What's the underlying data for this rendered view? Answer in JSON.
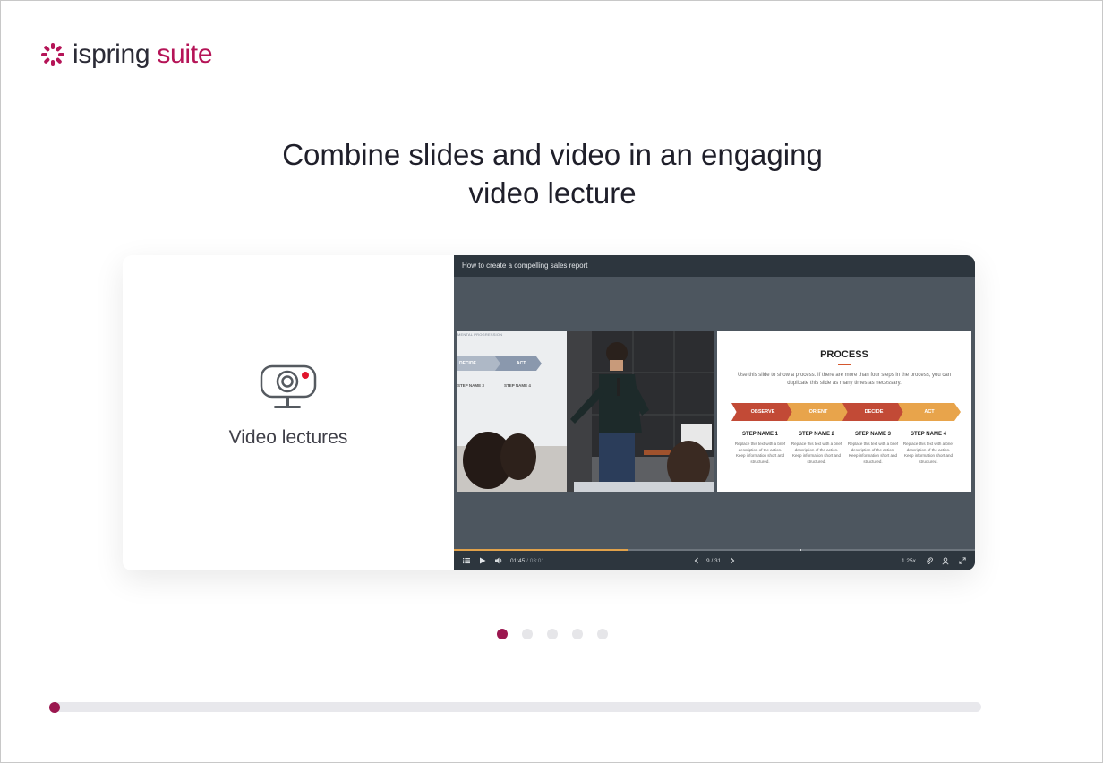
{
  "brand": {
    "name_part1": "ispring",
    "name_part2": "suite",
    "accent_color": "#b51457",
    "dark_color": "#2b2b36"
  },
  "headline": {
    "line1": "Combine slides and video in an engaging",
    "line2": "video lecture"
  },
  "feature": {
    "icon": "webcam-icon",
    "label": "Video lectures"
  },
  "player": {
    "title": "How to create a compelling sales report",
    "current_time": "01:45",
    "total_time": "03:01",
    "time_separator": " / ",
    "slide_counter": "9 / 31",
    "speed": "1.25x",
    "progress_fraction": 0.333,
    "progress_color": "#e0a14a",
    "icons": [
      "menu-icon",
      "play-icon",
      "volume-icon",
      "prev-icon",
      "next-icon",
      "attachment-icon",
      "presenter-icon",
      "fullscreen-icon"
    ]
  },
  "video": {
    "board_heading": "MENTAL PROGRESSION",
    "board_chevrons": [
      "DECIDE",
      "ACT"
    ],
    "board_steps": [
      "STEP NAME 3",
      "STEP NAME 4"
    ]
  },
  "slide": {
    "title": "PROCESS",
    "description": "Use this slide to show a process. If there are more than four steps in the process, you can duplicate this slide as many times as necessary.",
    "steps": [
      {
        "arrow": "OBSERVE",
        "name": "STEP NAME 1",
        "text": "Replace this text with a brief description of the action. Keep information short and structured.",
        "color": "#c24a36"
      },
      {
        "arrow": "ORIENT",
        "name": "STEP NAME 2",
        "text": "Replace this text with a brief description of the action. Keep information short and structured.",
        "color": "#e8a44b"
      },
      {
        "arrow": "DECIDE",
        "name": "STEP NAME 3",
        "text": "Replace this text with a brief description of the action. Keep information short and structured.",
        "color": "#c24a36"
      },
      {
        "arrow": "ACT",
        "name": "STEP NAME 4",
        "text": "Replace this text with a brief description of the action. Keep information short and structured.",
        "color": "#e8a44b"
      }
    ]
  },
  "carousel": {
    "count": 5,
    "active_index": 0
  },
  "course_progress": {
    "fraction": 0.0
  }
}
